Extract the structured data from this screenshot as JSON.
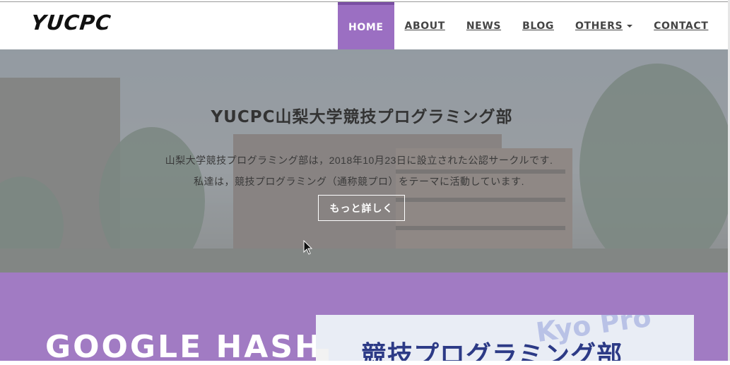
{
  "brand": "YUCPC",
  "nav": {
    "home": "HOME",
    "about": "ABOUT",
    "news": "NEWS",
    "blog": "BLOG",
    "others": "OTHERS",
    "contact": "CONTACT"
  },
  "hero": {
    "title": "YUCPC山梨大学競技プログラミング部",
    "line1": "山梨大学競技プログラミング部は，2018年10月23日に設立された公認サークルです.",
    "line2": "私達は，競技プログラミング（通称競プロ）をテーマに活動しています.",
    "button": "もっと詳しく"
  },
  "section": {
    "title": "GOOGLE HASH",
    "promo_text": "競技プログラミング部",
    "promo_bg": "Kyo Pro"
  },
  "colors": {
    "accent": "#9b6fc2",
    "section_bg": "#a17bc3"
  }
}
